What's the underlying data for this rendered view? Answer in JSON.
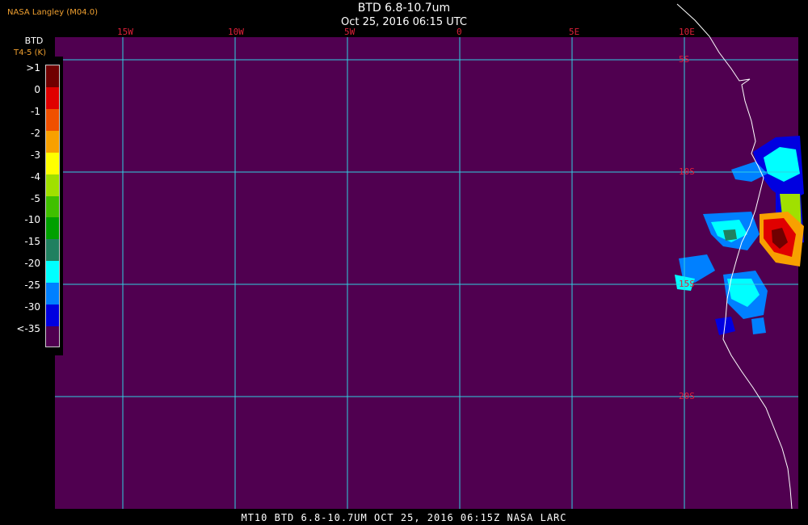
{
  "header": {
    "credit": "NASA Langley (M04.0)",
    "title": "BTD 6.8-10.7um",
    "subtitle": "Oct 25, 2016 06:15 UTC"
  },
  "legend": {
    "title": "BTD",
    "unit": "T4-5 (K)",
    "entries": [
      {
        "label": ">1",
        "color": "#700000"
      },
      {
        "label": "0",
        "color": "#e00000"
      },
      {
        "label": "-1",
        "color": "#f05000"
      },
      {
        "label": "-2",
        "color": "#f8a000"
      },
      {
        "label": "-3",
        "color": "#ffff00"
      },
      {
        "label": "-4",
        "color": "#a0e000"
      },
      {
        "label": "-5",
        "color": "#40c000"
      },
      {
        "label": "-10",
        "color": "#00a000"
      },
      {
        "label": "-15",
        "color": "#208060"
      },
      {
        "label": "-20",
        "color": "#00ffff"
      },
      {
        "label": "-25",
        "color": "#0080ff"
      },
      {
        "label": "-30",
        "color": "#0000e0"
      },
      {
        "label": "<-35",
        "color": "#500050"
      }
    ]
  },
  "grid": {
    "longitudes": [
      "15W",
      "10W",
      "5W",
      "0",
      "5E",
      "10E"
    ],
    "latitudes": [
      "5S",
      "10S",
      "15S",
      "20S"
    ],
    "line_color": "#30d0e0",
    "label_color": "#e0203a",
    "background_color": "#500050",
    "coast_color": "#ffffff"
  },
  "footer": {
    "text": "MT10  BTD 6.8-10.7UM   OCT 25, 2016 06:15Z   NASA LARC"
  }
}
